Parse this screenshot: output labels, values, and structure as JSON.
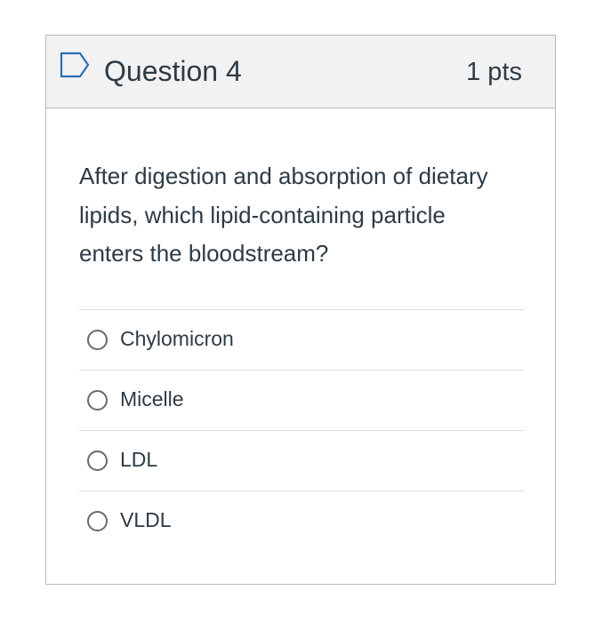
{
  "question": {
    "title": "Question 4",
    "points": "1 pts",
    "flag_icon": "flag-outline-icon",
    "text": "After digestion and absorption of dietary lipids, which lipid-containing particle enters the bloodstream?",
    "answers": [
      {
        "label": "Chylomicron",
        "selected": false
      },
      {
        "label": "Micelle",
        "selected": false
      },
      {
        "label": "LDL",
        "selected": false
      },
      {
        "label": "VLDL",
        "selected": false
      }
    ]
  },
  "colors": {
    "header_bg": "#f2f2f2",
    "border": "#b8b8b8",
    "text": "#2d3b45",
    "flag_outline": "#2d6db5"
  }
}
